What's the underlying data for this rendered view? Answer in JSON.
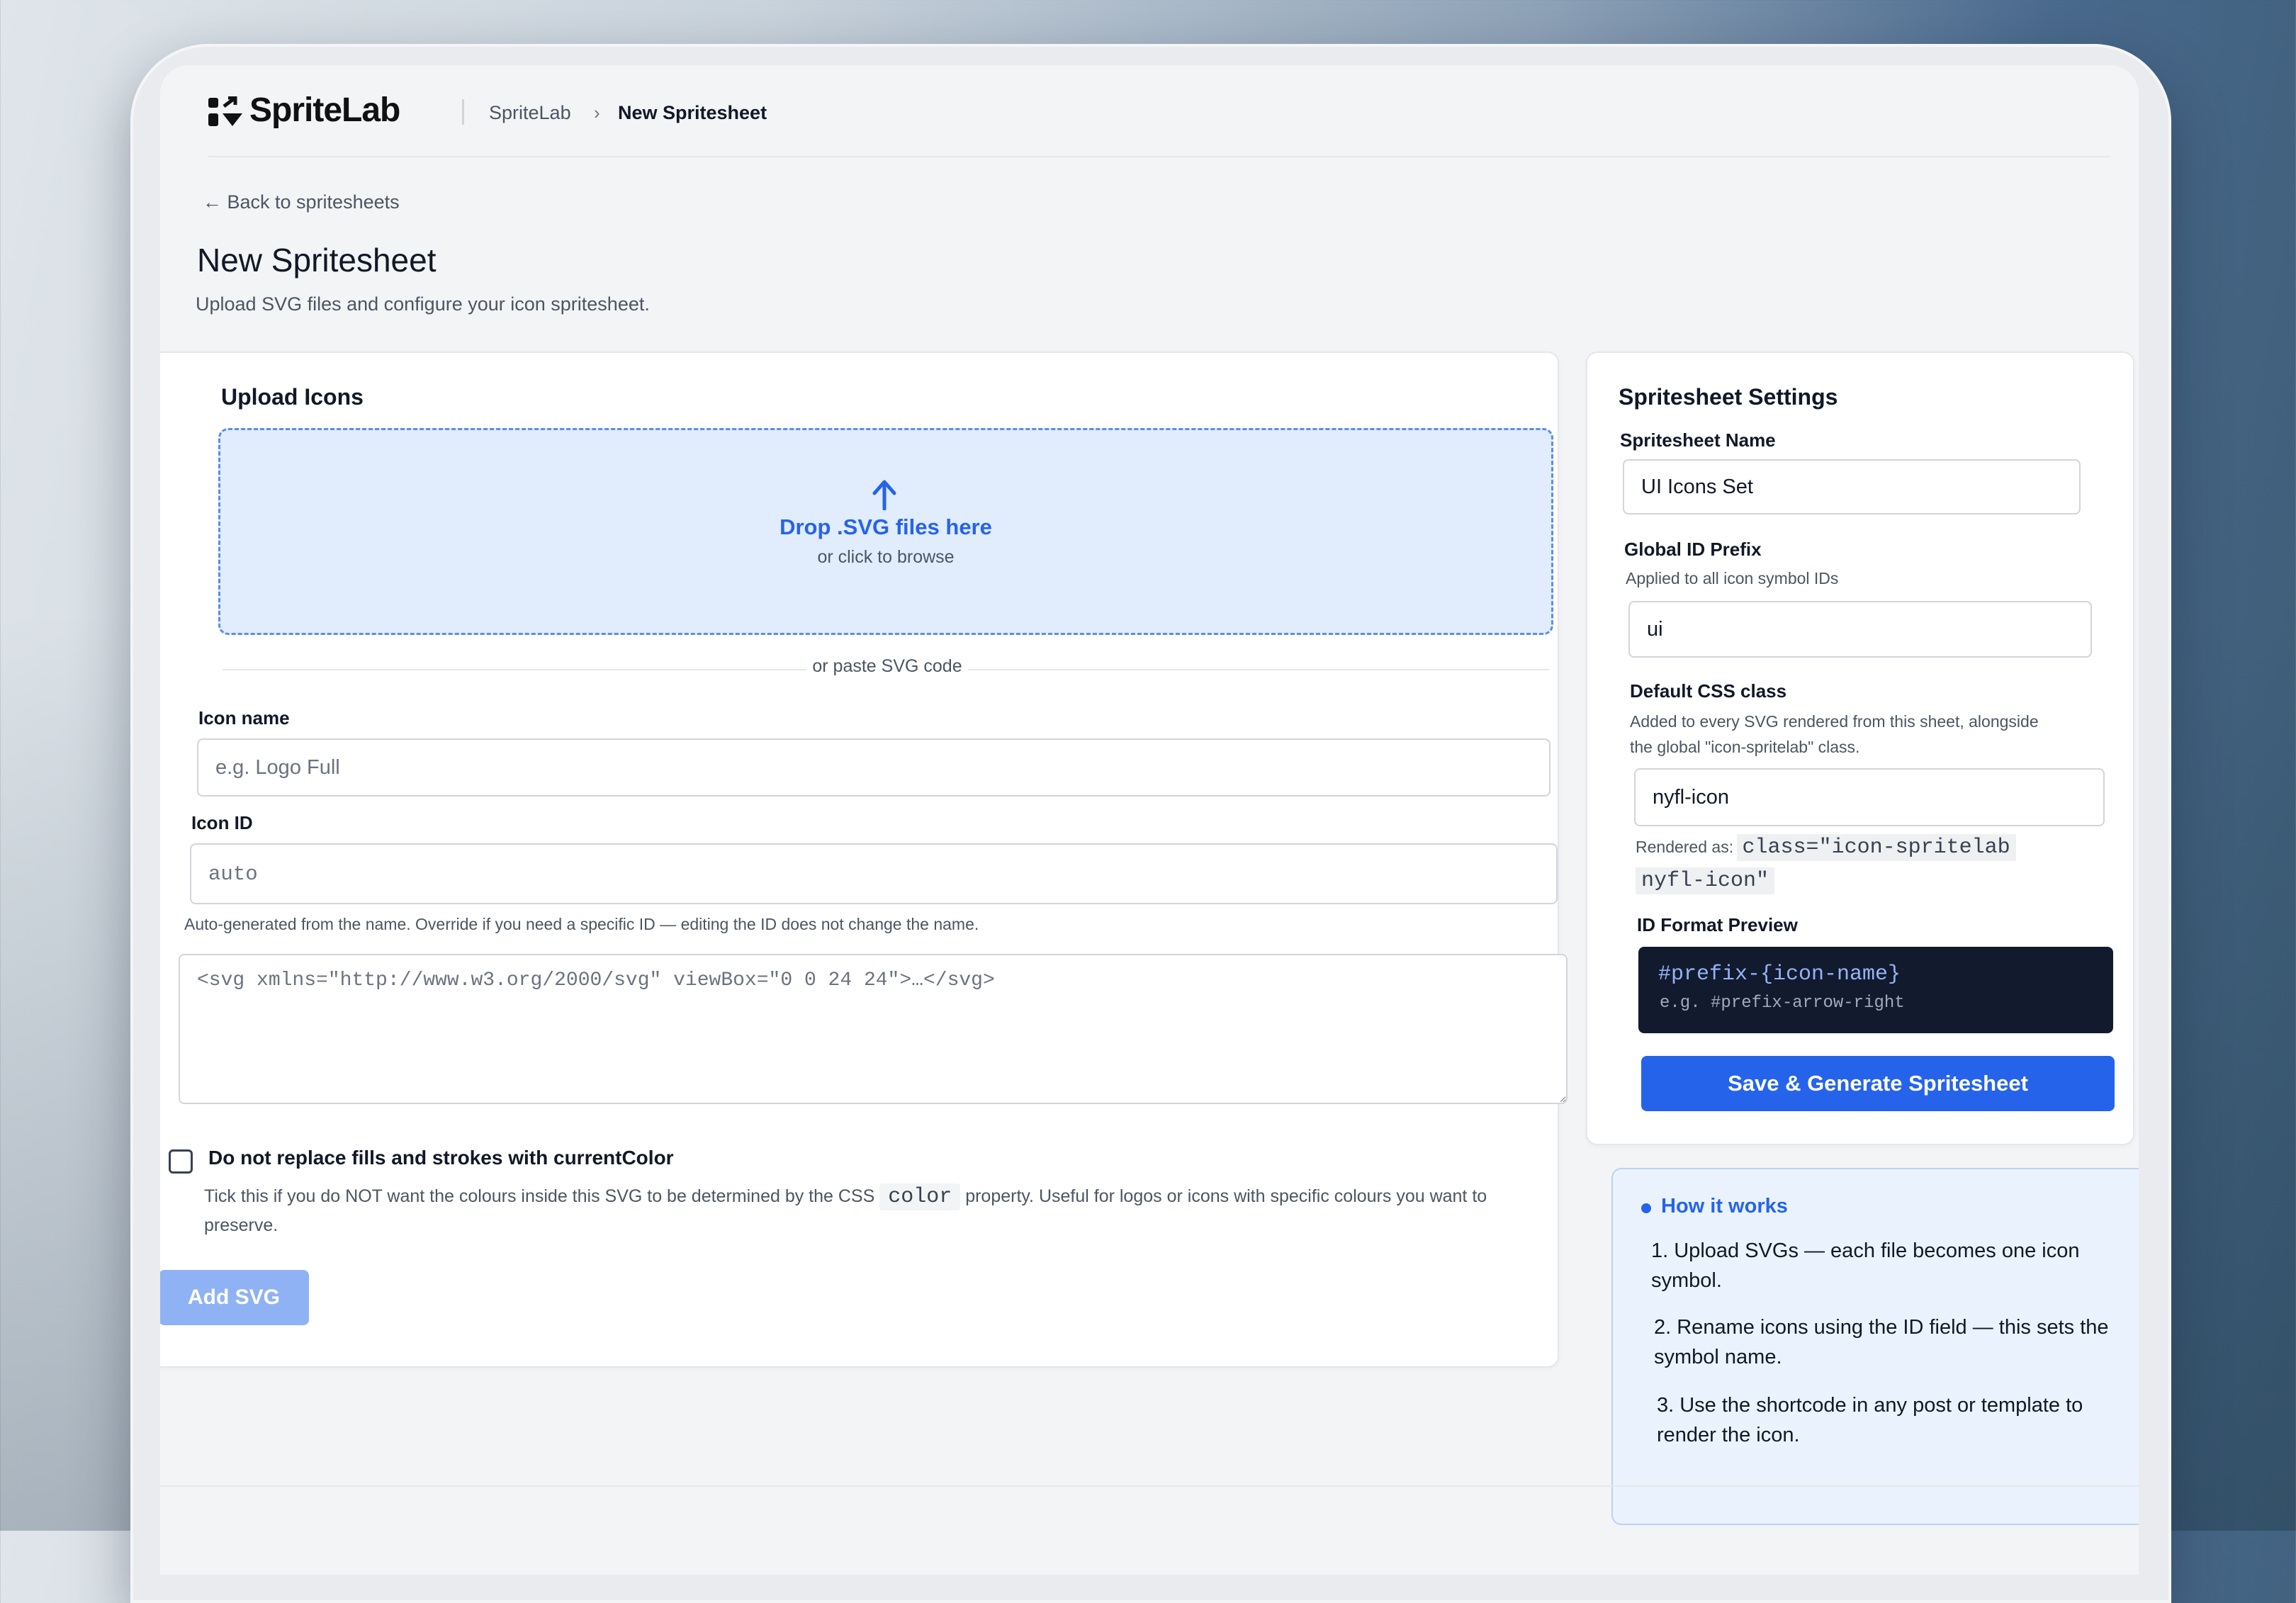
{
  "header": {
    "logo_text": "SpriteLab",
    "breadcrumb": [
      "SpriteLab",
      "New Spritesheet"
    ],
    "breadcrumb_separator": "›"
  },
  "back_link": "← Back to spritesheets",
  "page": {
    "title": "New Spritesheet",
    "subtitle": "Upload SVG files and configure your icon spritesheet."
  },
  "upload": {
    "title": "Upload Icons",
    "drop_title": "Drop .SVG files here",
    "drop_sub": "or click to browse",
    "divider_text": "or paste SVG code",
    "icon_name_label": "Icon name",
    "icon_name_placeholder": "e.g. Logo Full",
    "icon_id_label": "Icon ID",
    "icon_id_placeholder": "auto",
    "icon_id_hint": "Auto-generated from the name. Override if you need a specific ID — editing the ID does not change the name.",
    "svg_placeholder": "<svg xmlns=\"http://www.w3.org/2000/svg\" viewBox=\"0 0 24 24\">…</svg>",
    "checkbox_label": "Do not replace fills and strokes with currentColor",
    "checkbox_hint_pre": "Tick this if you do NOT want the colours inside this SVG to be determined by the CSS",
    "checkbox_hint_code": "color",
    "checkbox_hint_post": "property. Useful for logos or icons with specific colours you want to preserve.",
    "add_button": "Add SVG"
  },
  "settings": {
    "title": "Spritesheet Settings",
    "name_label": "Spritesheet Name",
    "name_value": "UI Icons Set",
    "prefix_label": "Global ID Prefix",
    "prefix_hint": "Applied to all icon symbol IDs",
    "prefix_value": "ui",
    "css_label": "Default CSS class",
    "css_hint": "Added to every SVG rendered from this sheet, alongside the global \"icon-spritelab\" class.",
    "css_value": "nyfl-icon",
    "rendered_label": "Rendered as:",
    "rendered_code_1": "class=\"icon-spritelab",
    "rendered_code_2": "nyfl-icon\"",
    "preview_label": "ID Format Preview",
    "preview_format": "#prefix-{icon-name}",
    "preview_example": "e.g. #prefix-arrow-right",
    "save_button": "Save & Generate Spritesheet"
  },
  "how_it_works": {
    "title": "How it works",
    "steps": [
      "1. Upload SVGs — each file becomes one icon symbol.",
      "2. Rename icons using the ID field — this sets the symbol name.",
      "3. Use the shortcode in any post or template to render the icon."
    ]
  },
  "colors": {
    "accent": "#2563eb",
    "dropzone_bg": "#e1ecfd",
    "preview_bg": "#121a2e",
    "add_button_disabled": "#8fb2f5"
  }
}
